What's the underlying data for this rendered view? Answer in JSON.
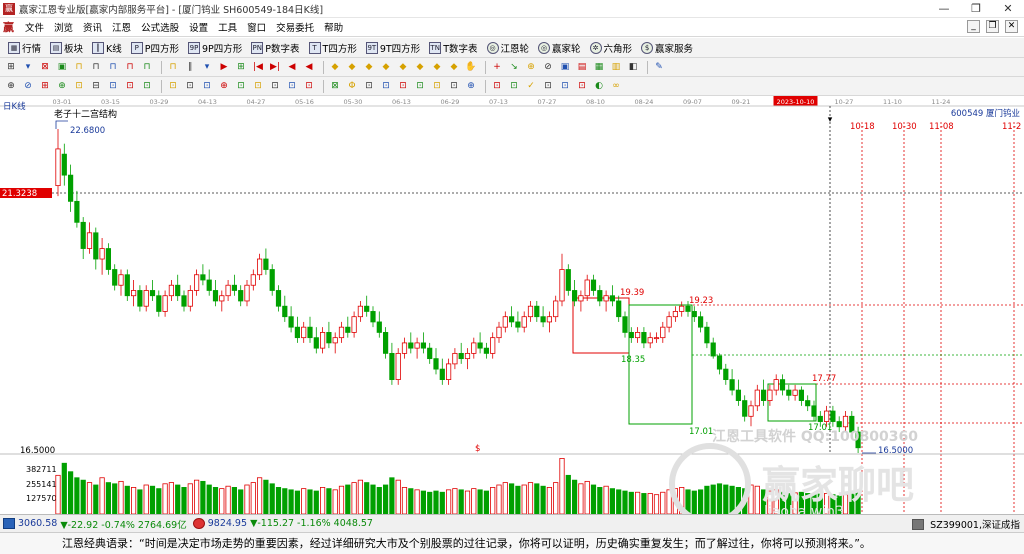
{
  "window": {
    "app_icon": "赢",
    "title": "赢家江恩专业版[赢家内部服务平台] - [厦门钨业  SH600549-184日K线]",
    "controls": [
      "—",
      "❐",
      "✕"
    ]
  },
  "menu": {
    "logo": "赢",
    "items": [
      "文件",
      "浏览",
      "资讯",
      "江恩",
      "公式选股",
      "设置",
      "工具",
      "窗口",
      "交易委托",
      "帮助"
    ],
    "mdi_controls": [
      "_",
      "❐",
      "✕"
    ]
  },
  "toolbar1": {
    "items": [
      {
        "icon": "grid-icon",
        "glyph": "▦",
        "label": "行情"
      },
      {
        "icon": "blocks-icon",
        "glyph": "▤",
        "label": "板块"
      },
      {
        "icon": "candles-icon",
        "glyph": "┃",
        "label": "K线"
      },
      {
        "icon": "p-square-icon",
        "glyph": "P",
        "label": "P四方形"
      },
      {
        "icon": "9p-square-icon",
        "glyph": "9P",
        "label": "9P四方形"
      },
      {
        "icon": "pn-table-icon",
        "glyph": "PN",
        "label": "P数字表"
      },
      {
        "icon": "t-square-icon",
        "glyph": "T",
        "label": "T四方形"
      },
      {
        "icon": "9t-square-icon",
        "glyph": "9T",
        "label": "9T四方形"
      },
      {
        "icon": "tn-table-icon",
        "glyph": "TN",
        "label": "T数字表"
      },
      {
        "icon": "gann-wheel-icon",
        "glyph": "◎",
        "label": "江恩轮",
        "round": true
      },
      {
        "icon": "winner-wheel-icon",
        "glyph": "◎",
        "label": "赢家轮",
        "round": true
      },
      {
        "icon": "hexagon-icon",
        "glyph": "✲",
        "label": "六角形",
        "round": true
      },
      {
        "icon": "winner-service-icon",
        "glyph": "$",
        "label": "赢家服务",
        "round": true
      }
    ]
  },
  "toolbar2": {
    "glyphs": [
      "⊞",
      "▾",
      "⊠",
      "▣",
      "⊓",
      "⊓",
      "⊓",
      "⊓",
      "⊓",
      "⊓",
      "∥",
      "▾",
      "▶",
      "⊞",
      "|◀",
      "▶|",
      "◀",
      "◀",
      "◆",
      "◆",
      "◆",
      "◆",
      "◆",
      "◆",
      "◆",
      "◆",
      "✋",
      "+",
      "↘",
      "⊕",
      "⊘",
      "▣",
      "▤",
      "▦",
      "▥",
      "◧",
      "✎"
    ]
  },
  "toolbar3": {
    "glyphs": [
      "⊕",
      "⊘",
      "⊞",
      "⊕",
      "⊡",
      "⊟",
      "⊡",
      "⊡",
      "⊡",
      "⊡",
      "⊡",
      "⊡",
      "⊕",
      "⊡",
      "⊡",
      "⊡",
      "⊡",
      "⊡",
      "⊠",
      "Φ",
      "⊡",
      "⊡",
      "⊡",
      "⊡",
      "⊡",
      "⊡",
      "⊕",
      "⊡",
      "⊡",
      "✓",
      "⊡",
      "⊡",
      "⊡",
      "◐",
      "∞"
    ]
  },
  "chart": {
    "period_label": "日K线",
    "top_dates": [
      "03-01",
      "03-15",
      "03-29",
      "04-13",
      "04-27",
      "05-16",
      "05-30",
      "06-13",
      "06-29",
      "07-13",
      "07-27",
      "08-10",
      "08-24",
      "09-07",
      "09-21",
      "2023-10-10",
      "10-27",
      "11-10",
      "11-24"
    ],
    "highlight_date": "2023-10-10",
    "stock_info": "600549  厦门钨业",
    "indicator_title": "老子十二宫结构",
    "price_labels": {
      "high": "22.6800",
      "crosshair": "21.3238",
      "left_low": "16.5000",
      "low": "16.5000",
      "box1_top": "19.39",
      "box2_top": "19.23",
      "box2_mid": "18.35",
      "box2_bottom": "17.01",
      "box3_top": "17.77",
      "box3_bottom": "17.01"
    },
    "future_dates": [
      "10-18",
      "10-30",
      "11-08",
      "11-2"
    ],
    "volume_labels": [
      "382711",
      "255141",
      "127570"
    ],
    "volume_marker": "$",
    "watermark_text": "江恩工具软件  QQ:100800360",
    "watermark_logo": "赢家聊吧",
    "watermark_url": "liaoba.win3"
  },
  "chart_data": {
    "type": "candlestick",
    "ohlc": [
      [
        21.6,
        22.68,
        21.4,
        22.3
      ],
      [
        22.2,
        22.4,
        21.6,
        21.8
      ],
      [
        21.8,
        22.0,
        21.1,
        21.3
      ],
      [
        21.3,
        21.5,
        20.8,
        20.9
      ],
      [
        20.9,
        21.0,
        20.2,
        20.4
      ],
      [
        20.4,
        20.9,
        20.3,
        20.7
      ],
      [
        20.7,
        20.8,
        20.0,
        20.2
      ],
      [
        20.2,
        20.6,
        19.9,
        20.4
      ],
      [
        20.4,
        20.5,
        19.9,
        20.0
      ],
      [
        20.0,
        20.1,
        19.6,
        19.7
      ],
      [
        19.7,
        20.0,
        19.5,
        19.9
      ],
      [
        19.9,
        20.0,
        19.4,
        19.5
      ],
      [
        19.5,
        19.8,
        19.3,
        19.6
      ],
      [
        19.6,
        19.7,
        19.2,
        19.3
      ],
      [
        19.3,
        19.7,
        19.2,
        19.6
      ],
      [
        19.6,
        19.8,
        19.4,
        19.5
      ],
      [
        19.5,
        19.6,
        19.1,
        19.2
      ],
      [
        19.2,
        19.6,
        19.1,
        19.5
      ],
      [
        19.5,
        19.8,
        19.4,
        19.7
      ],
      [
        19.7,
        19.9,
        19.4,
        19.5
      ],
      [
        19.5,
        19.6,
        19.2,
        19.3
      ],
      [
        19.3,
        19.7,
        19.2,
        19.6
      ],
      [
        19.6,
        20.0,
        19.5,
        19.9
      ],
      [
        19.9,
        20.1,
        19.7,
        19.8
      ],
      [
        19.8,
        20.0,
        19.5,
        19.6
      ],
      [
        19.6,
        19.8,
        19.3,
        19.4
      ],
      [
        19.4,
        19.6,
        19.2,
        19.5
      ],
      [
        19.5,
        19.8,
        19.4,
        19.7
      ],
      [
        19.7,
        19.9,
        19.5,
        19.6
      ],
      [
        19.6,
        19.7,
        19.3,
        19.4
      ],
      [
        19.4,
        19.8,
        19.3,
        19.7
      ],
      [
        19.7,
        20.0,
        19.6,
        19.9
      ],
      [
        19.9,
        20.3,
        19.8,
        20.2
      ],
      [
        20.2,
        20.4,
        19.9,
        20.0
      ],
      [
        20.0,
        20.1,
        19.5,
        19.6
      ],
      [
        19.6,
        19.7,
        19.2,
        19.3
      ],
      [
        19.3,
        19.5,
        19.0,
        19.1
      ],
      [
        19.1,
        19.3,
        18.8,
        18.9
      ],
      [
        18.9,
        19.1,
        18.6,
        18.7
      ],
      [
        18.7,
        19.0,
        18.6,
        18.9
      ],
      [
        18.9,
        19.1,
        18.6,
        18.7
      ],
      [
        18.7,
        18.9,
        18.4,
        18.5
      ],
      [
        18.5,
        18.9,
        18.4,
        18.8
      ],
      [
        18.8,
        19.0,
        18.5,
        18.6
      ],
      [
        18.6,
        18.8,
        18.4,
        18.7
      ],
      [
        18.7,
        19.0,
        18.6,
        18.9
      ],
      [
        18.9,
        19.1,
        18.7,
        18.8
      ],
      [
        18.8,
        19.2,
        18.7,
        19.1
      ],
      [
        19.1,
        19.4,
        19.0,
        19.3
      ],
      [
        19.3,
        19.5,
        19.1,
        19.2
      ],
      [
        19.2,
        19.3,
        18.9,
        19.0
      ],
      [
        19.0,
        19.2,
        18.7,
        18.8
      ],
      [
        18.8,
        18.9,
        18.3,
        18.4
      ],
      [
        18.4,
        18.6,
        17.8,
        17.9
      ],
      [
        17.9,
        18.5,
        17.8,
        18.4
      ],
      [
        18.4,
        18.7,
        18.3,
        18.6
      ],
      [
        18.6,
        18.8,
        18.4,
        18.5
      ],
      [
        18.5,
        18.7,
        18.3,
        18.6
      ],
      [
        18.6,
        18.8,
        18.4,
        18.5
      ],
      [
        18.5,
        18.6,
        18.2,
        18.3
      ],
      [
        18.3,
        18.5,
        18.0,
        18.1
      ],
      [
        18.1,
        18.3,
        17.8,
        17.9
      ],
      [
        17.9,
        18.3,
        17.8,
        18.2
      ],
      [
        18.2,
        18.5,
        18.1,
        18.4
      ],
      [
        18.4,
        18.6,
        18.2,
        18.3
      ],
      [
        18.3,
        18.5,
        18.1,
        18.4
      ],
      [
        18.4,
        18.7,
        18.3,
        18.6
      ],
      [
        18.6,
        18.8,
        18.4,
        18.5
      ],
      [
        18.5,
        18.6,
        18.3,
        18.4
      ],
      [
        18.4,
        18.8,
        18.3,
        18.7
      ],
      [
        18.7,
        19.0,
        18.6,
        18.9
      ],
      [
        18.9,
        19.2,
        18.8,
        19.1
      ],
      [
        19.1,
        19.3,
        18.9,
        19.0
      ],
      [
        19.0,
        19.2,
        18.8,
        18.9
      ],
      [
        18.9,
        19.2,
        18.8,
        19.1
      ],
      [
        19.1,
        19.4,
        19.0,
        19.3
      ],
      [
        19.3,
        19.4,
        19.0,
        19.1
      ],
      [
        19.1,
        19.3,
        18.9,
        19.0
      ],
      [
        19.0,
        19.2,
        18.8,
        19.1
      ],
      [
        19.1,
        19.5,
        19.0,
        19.4
      ],
      [
        19.4,
        20.3,
        19.3,
        20.0
      ],
      [
        20.0,
        20.1,
        19.5,
        19.6
      ],
      [
        19.6,
        19.8,
        19.3,
        19.4
      ],
      [
        19.4,
        19.6,
        19.2,
        19.5
      ],
      [
        19.5,
        19.9,
        19.4,
        19.8
      ],
      [
        19.8,
        19.9,
        19.5,
        19.6
      ],
      [
        19.6,
        19.7,
        19.3,
        19.4
      ],
      [
        19.4,
        19.6,
        19.2,
        19.5
      ],
      [
        19.5,
        19.7,
        19.3,
        19.4
      ],
      [
        19.4,
        19.5,
        19.0,
        19.1
      ],
      [
        19.1,
        19.2,
        18.7,
        18.8
      ],
      [
        18.8,
        18.9,
        18.6,
        18.7
      ],
      [
        18.7,
        18.9,
        18.6,
        18.8
      ],
      [
        18.8,
        18.9,
        18.5,
        18.6
      ],
      [
        18.6,
        18.8,
        18.5,
        18.7
      ],
      [
        18.7,
        18.8,
        18.6,
        18.7
      ],
      [
        18.7,
        19.0,
        18.6,
        18.9
      ],
      [
        18.9,
        19.2,
        18.8,
        19.1
      ],
      [
        19.1,
        19.3,
        19.0,
        19.2
      ],
      [
        19.2,
        19.39,
        19.1,
        19.3
      ],
      [
        19.3,
        19.4,
        19.1,
        19.2
      ],
      [
        19.2,
        19.3,
        19.0,
        19.1
      ],
      [
        19.1,
        19.2,
        18.8,
        18.9
      ],
      [
        18.9,
        19.0,
        18.5,
        18.6
      ],
      [
        18.6,
        18.7,
        18.3,
        18.35
      ],
      [
        18.35,
        18.4,
        18.0,
        18.1
      ],
      [
        18.1,
        18.2,
        17.8,
        17.9
      ],
      [
        17.9,
        18.1,
        17.6,
        17.7
      ],
      [
        17.7,
        17.9,
        17.4,
        17.5
      ],
      [
        17.5,
        17.6,
        17.1,
        17.2
      ],
      [
        17.2,
        17.5,
        17.01,
        17.4
      ],
      [
        17.4,
        17.8,
        17.3,
        17.7
      ],
      [
        17.7,
        17.9,
        17.4,
        17.5
      ],
      [
        17.5,
        17.8,
        17.4,
        17.7
      ],
      [
        17.7,
        18.0,
        17.6,
        17.9
      ],
      [
        17.9,
        18.0,
        17.6,
        17.7
      ],
      [
        17.7,
        17.8,
        17.5,
        17.6
      ],
      [
        17.6,
        17.8,
        17.5,
        17.7
      ],
      [
        17.7,
        17.77,
        17.4,
        17.5
      ],
      [
        17.5,
        17.6,
        17.3,
        17.4
      ],
      [
        17.4,
        17.5,
        17.1,
        17.2
      ],
      [
        17.2,
        17.3,
        17.0,
        17.1
      ],
      [
        17.1,
        17.4,
        17.0,
        17.3
      ],
      [
        17.3,
        17.4,
        17.0,
        17.1
      ],
      [
        17.1,
        17.2,
        16.9,
        17.0
      ],
      [
        17.0,
        17.3,
        16.9,
        17.2
      ],
      [
        17.2,
        17.3,
        16.8,
        16.9
      ],
      [
        16.9,
        17.0,
        16.5,
        16.6
      ]
    ],
    "volume": [
      320,
      420,
      350,
      300,
      280,
      260,
      240,
      300,
      260,
      250,
      270,
      230,
      220,
      200,
      240,
      230,
      210,
      250,
      260,
      240,
      220,
      250,
      280,
      270,
      240,
      220,
      210,
      230,
      220,
      200,
      240,
      260,
      300,
      280,
      250,
      220,
      210,
      200,
      190,
      210,
      200,
      190,
      220,
      210,
      200,
      230,
      240,
      260,
      280,
      260,
      240,
      220,
      240,
      300,
      280,
      220,
      210,
      200,
      190,
      180,
      190,
      180,
      200,
      210,
      200,
      190,
      210,
      200,
      190,
      220,
      240,
      260,
      250,
      230,
      240,
      260,
      250,
      230,
      220,
      260,
      460,
      320,
      280,
      250,
      270,
      240,
      220,
      230,
      210,
      200,
      190,
      180,
      180,
      170,
      170,
      160,
      180,
      200,
      210,
      220,
      200,
      190,
      200,
      230,
      240,
      250,
      240,
      230,
      220,
      210,
      240,
      230,
      200,
      190,
      200,
      180,
      170,
      175,
      180,
      170,
      160,
      165,
      170,
      160,
      150,
      160,
      170,
      180
    ],
    "ylim": [
      16.5,
      22.68
    ]
  },
  "status": {
    "idx1_value": "3060.58",
    "idx1_change": "▼-22.92 -0.74% 2764.69亿",
    "idx2_value": "9824.95",
    "idx2_change": "▼-115.27 -1.16% 4048.57",
    "right_code": "SZ399001,深证成指"
  },
  "footer": {
    "quote": "江恩经典语录：“时间是决定市场走势的重要因素，经过详细研究大市及个别股票的过往记录，你将可以证明，历史确实重复发生；而了解过往，你将可以预测将来。”。"
  }
}
